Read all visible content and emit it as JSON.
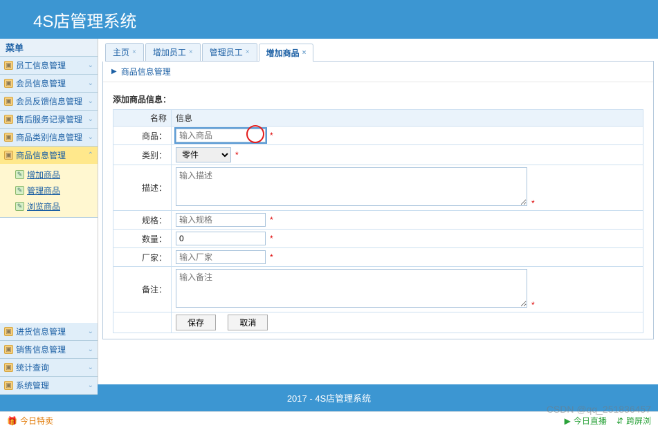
{
  "header": {
    "title": "4S店管理系统"
  },
  "sidebar": {
    "title": "菜单",
    "panels": [
      {
        "label": "员工信息管理"
      },
      {
        "label": "会员信息管理"
      },
      {
        "label": "会员反馈信息管理"
      },
      {
        "label": "售后服务记录管理"
      },
      {
        "label": "商品类别信息管理"
      },
      {
        "label": "商品信息管理",
        "active": true
      },
      {
        "label": "进货信息管理"
      },
      {
        "label": "销售信息管理"
      },
      {
        "label": "统计查询"
      },
      {
        "label": "系统管理"
      }
    ],
    "children": [
      {
        "label": "增加商品"
      },
      {
        "label": "管理商品"
      },
      {
        "label": "浏览商品"
      }
    ]
  },
  "tabs": [
    {
      "label": "主页",
      "active": false
    },
    {
      "label": "增加员工",
      "active": false
    },
    {
      "label": "管理员工",
      "active": false
    },
    {
      "label": "增加商品",
      "active": true
    }
  ],
  "breadcrumb": "商品信息管理",
  "form": {
    "section_title": "添加商品信息：",
    "col_name": "名称",
    "col_info": "信息",
    "product_label": "商品：",
    "product_placeholder": "输入商品",
    "product_value": "",
    "category_label": "类别：",
    "category_option": "零件",
    "desc_label": "描述：",
    "desc_placeholder": "输入描述",
    "spec_label": "规格：",
    "spec_placeholder": "输入规格",
    "qty_label": "数量：",
    "qty_value": "0",
    "mfr_label": "厂家：",
    "mfr_placeholder": "输入厂家",
    "note_label": "备注：",
    "note_placeholder": "输入备注",
    "asterisk": "*",
    "save": "保存",
    "cancel": "取消"
  },
  "footer": "2017 - 4S店管理系统",
  "bottombar": {
    "left": "今日特卖",
    "live": "今日直播",
    "cast": "跨屏浏",
    "watermark": "CSDN @qq_251836457"
  }
}
